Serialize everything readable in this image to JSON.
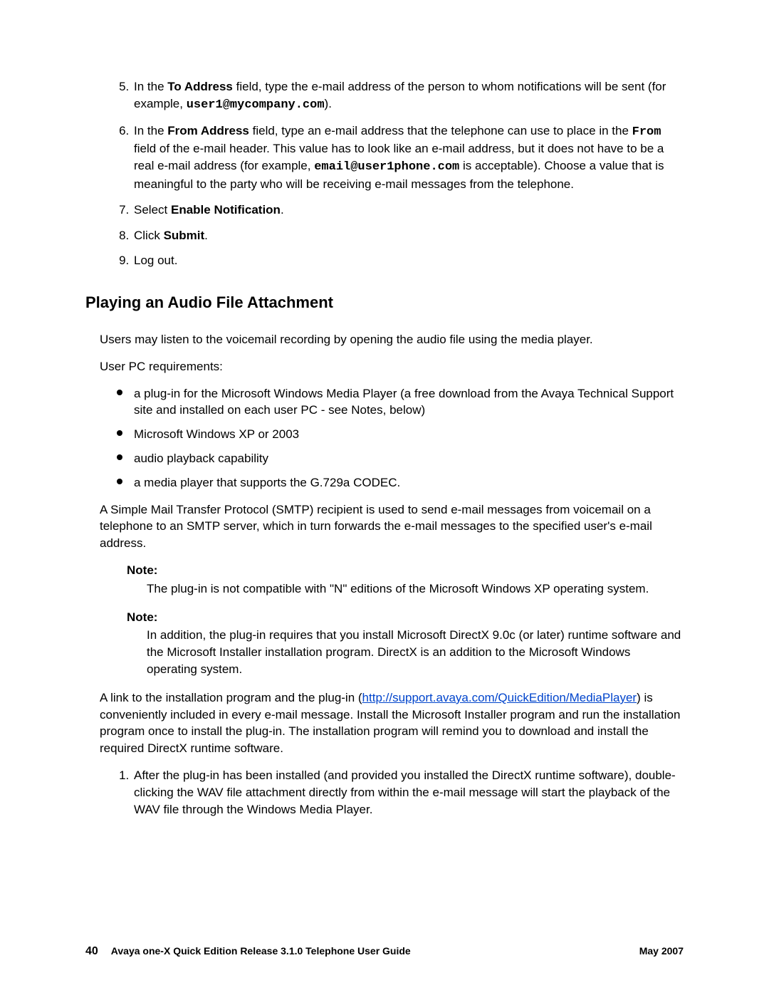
{
  "steps_first": [
    {
      "num": "5",
      "html": "In the <b>To Address</b> field, type the e-mail address of the person to whom notifications will be sent (for example, <span class='code'>user1@mycompany.com</span>)."
    },
    {
      "num": "6",
      "html": "In the <b>From Address</b> field, type an e-mail address that the telephone can use to place in the <span class='code'>From</span> field of the e-mail header. This value has to look like an e-mail address, but it does not have to be a real e-mail address (for example, <span class='code'>email@user1phone.com</span> is acceptable). Choose a value that is meaningful to the party who will be receiving e-mail messages from the telephone."
    },
    {
      "num": "7",
      "html": "Select <b>Enable Notification</b>."
    },
    {
      "num": "8",
      "html": "Click <b>Submit</b>."
    },
    {
      "num": "9",
      "html": "Log out."
    }
  ],
  "heading": "Playing an Audio File Attachment",
  "para_intro": "Users may listen to the voicemail recording by opening the audio file using the media player.",
  "para_req_label": "User PC requirements:",
  "bullets": [
    "a plug-in for the Microsoft Windows Media Player (a free download from the Avaya Technical Support site and installed on each user PC - see Notes, below)",
    "Microsoft Windows XP or 2003",
    "audio playback capability",
    "a media player that supports the G.729a CODEC."
  ],
  "para_smtp": "A Simple Mail Transfer Protocol (SMTP) recipient is used to send e-mail messages from voicemail on a telephone to an SMTP server, which in turn forwards the e-mail messages to the specified user's e-mail address.",
  "note1_label": "Note:",
  "note1_body": "The plug-in is not compatible with \"N\" editions of the Microsoft Windows XP operating system.",
  "note2_label": "Note:",
  "note2_body": "In addition, the plug-in requires that you install Microsoft DirectX 9.0c (or later) runtime software and the Microsoft Installer installation program. DirectX is an addition to the Microsoft Windows operating system.",
  "para_link_prefix": "A link to the installation program and the plug-in (",
  "link_text": "http://support.avaya.com/QuickEdition/MediaPlayer",
  "link_href": "http://support.avaya.com/QuickEdition/MediaPlayer",
  "para_link_suffix": ") is conveniently included in every e-mail message. Install the Microsoft Installer program and run the installation program once to install the plug-in. The installation program will remind you to download and install the required DirectX runtime software.",
  "steps_second": [
    {
      "num": "1",
      "html": "After the plug-in has been installed (and provided you installed the DirectX runtime software), double-clicking the WAV file attachment directly from within the e-mail message will start the playback of the WAV file through the Windows Media Player."
    }
  ],
  "footer_page": "40",
  "footer_title": "Avaya one-X Quick Edition Release 3.1.0 Telephone User Guide",
  "footer_date": "May 2007"
}
